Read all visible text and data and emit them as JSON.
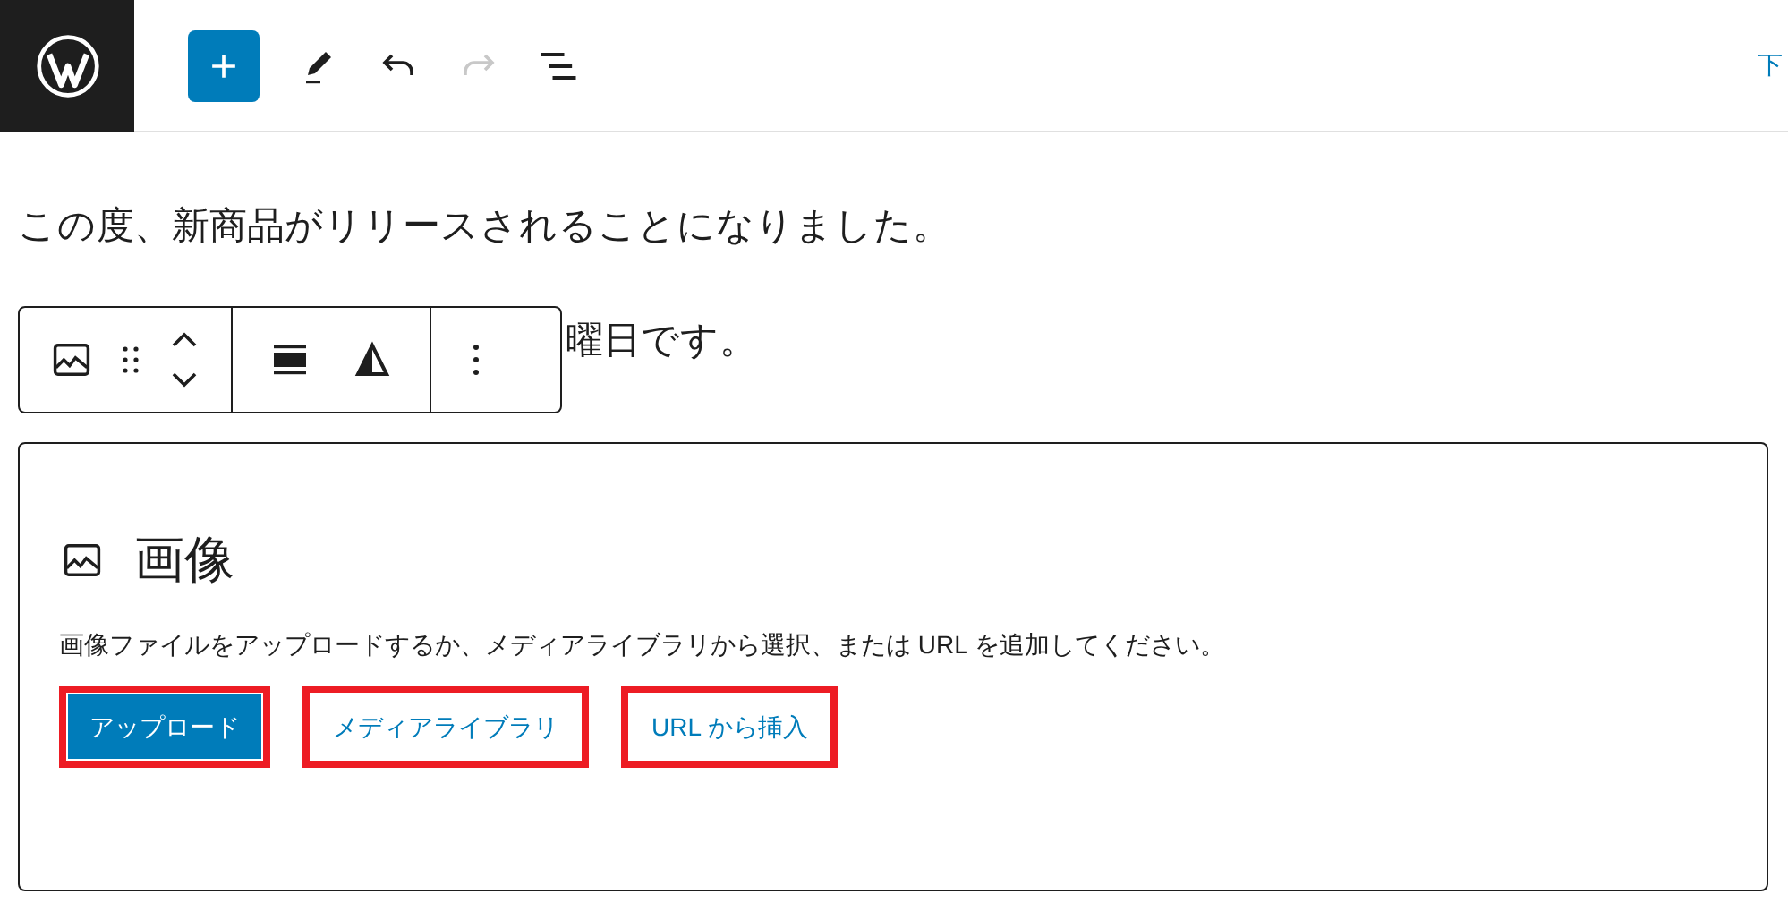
{
  "header": {
    "draft_link": "下"
  },
  "paragraphs": [
    "この度、新商品がリリースされることになりました。",
    "曜日です。"
  ],
  "image_block": {
    "title": "画像",
    "description": "画像ファイルをアップロードするか、メディアライブラリから選択、または URL を追加してください。",
    "buttons": [
      {
        "label": "アップロード",
        "kind": "primary",
        "highlighted": true
      },
      {
        "label": "メディアライブラリ",
        "kind": "link",
        "highlighted": true
      },
      {
        "label": "URL から挿入",
        "kind": "link",
        "highlighted": true
      }
    ]
  }
}
